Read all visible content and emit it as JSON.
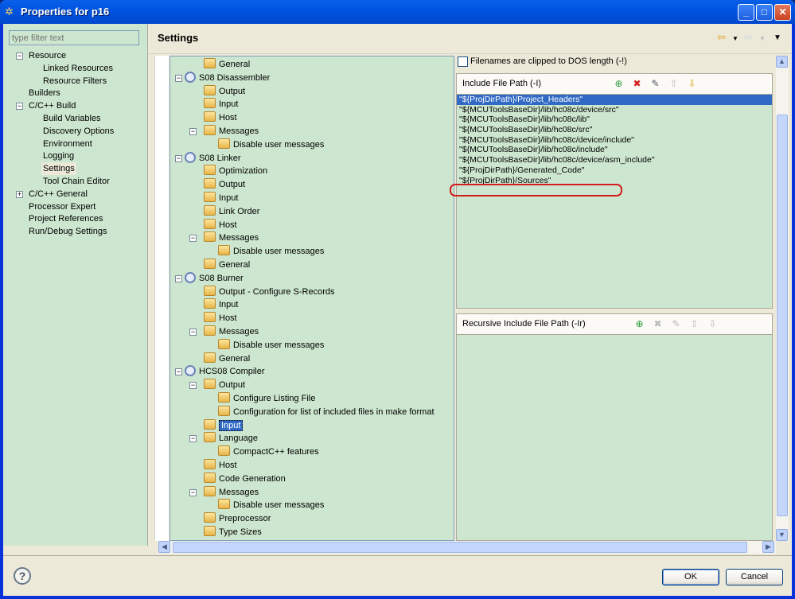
{
  "window": {
    "title": "Properties for p16",
    "controls": [
      "minimize",
      "maximize",
      "close"
    ]
  },
  "left": {
    "filter_placeholder": "type filter text",
    "items": [
      {
        "label": "Resource",
        "level": 0,
        "expander": "−"
      },
      {
        "label": "Linked Resources",
        "level": 1
      },
      {
        "label": "Resource Filters",
        "level": 1
      },
      {
        "label": "Builders",
        "level": 0
      },
      {
        "label": "C/C++ Build",
        "level": 0,
        "expander": "−"
      },
      {
        "label": "Build Variables",
        "level": 1
      },
      {
        "label": "Discovery Options",
        "level": 1
      },
      {
        "label": "Environment",
        "level": 1
      },
      {
        "label": "Logging",
        "level": 1
      },
      {
        "label": "Settings",
        "level": 1,
        "selected": true
      },
      {
        "label": "Tool Chain Editor",
        "level": 1
      },
      {
        "label": "C/C++ General",
        "level": 0,
        "expander": "+"
      },
      {
        "label": "Processor Expert",
        "level": 0
      },
      {
        "label": "Project References",
        "level": 0
      },
      {
        "label": "Run/Debug Settings",
        "level": 0
      }
    ]
  },
  "header": {
    "title": "Settings"
  },
  "tool_tree": [
    {
      "label": "General",
      "level": 1,
      "icon": "folder"
    },
    {
      "label": "S08 Disassembler",
      "level": 0,
      "icon": "tool",
      "expander": "−"
    },
    {
      "label": "Output",
      "level": 1,
      "icon": "folder"
    },
    {
      "label": "Input",
      "level": 1,
      "icon": "folder"
    },
    {
      "label": "Host",
      "level": 1,
      "icon": "folder"
    },
    {
      "label": "Messages",
      "level": 1,
      "icon": "folder",
      "expander": "−"
    },
    {
      "label": "Disable user messages",
      "level": 2,
      "icon": "folder"
    },
    {
      "label": "S08 Linker",
      "level": 0,
      "icon": "tool",
      "expander": "−"
    },
    {
      "label": "Optimization",
      "level": 1,
      "icon": "folder"
    },
    {
      "label": "Output",
      "level": 1,
      "icon": "folder"
    },
    {
      "label": "Input",
      "level": 1,
      "icon": "folder"
    },
    {
      "label": "Link Order",
      "level": 1,
      "icon": "folder"
    },
    {
      "label": "Host",
      "level": 1,
      "icon": "folder"
    },
    {
      "label": "Messages",
      "level": 1,
      "icon": "folder",
      "expander": "−"
    },
    {
      "label": "Disable user messages",
      "level": 2,
      "icon": "folder"
    },
    {
      "label": "General",
      "level": 1,
      "icon": "folder"
    },
    {
      "label": "S08 Burner",
      "level": 0,
      "icon": "tool",
      "expander": "−"
    },
    {
      "label": "Output - Configure S-Records",
      "level": 1,
      "icon": "folder"
    },
    {
      "label": "Input",
      "level": 1,
      "icon": "folder"
    },
    {
      "label": "Host",
      "level": 1,
      "icon": "folder"
    },
    {
      "label": "Messages",
      "level": 1,
      "icon": "folder",
      "expander": "−"
    },
    {
      "label": "Disable user messages",
      "level": 2,
      "icon": "folder"
    },
    {
      "label": "General",
      "level": 1,
      "icon": "folder"
    },
    {
      "label": "HCS08 Compiler",
      "level": 0,
      "icon": "tool",
      "expander": "−"
    },
    {
      "label": "Output",
      "level": 1,
      "icon": "folder",
      "expander": "−"
    },
    {
      "label": "Configure Listing File",
      "level": 2,
      "icon": "folder"
    },
    {
      "label": "Configuration for list of included files in make format",
      "level": 2,
      "icon": "folder"
    },
    {
      "label": "Input",
      "level": 1,
      "icon": "folder",
      "selected": true
    },
    {
      "label": "Language",
      "level": 1,
      "icon": "folder",
      "expander": "−"
    },
    {
      "label": "CompactC++ features",
      "level": 2,
      "icon": "folder"
    },
    {
      "label": "Host",
      "level": 1,
      "icon": "folder"
    },
    {
      "label": "Code Generation",
      "level": 1,
      "icon": "folder"
    },
    {
      "label": "Messages",
      "level": 1,
      "icon": "folder",
      "expander": "−"
    },
    {
      "label": "Disable user messages",
      "level": 2,
      "icon": "folder"
    },
    {
      "label": "Preprocessor",
      "level": 1,
      "icon": "folder"
    },
    {
      "label": "Type Sizes",
      "level": 1,
      "icon": "folder"
    }
  ],
  "options": {
    "dos_checkbox": {
      "label": "Filenames are clipped to DOS length (-!)",
      "checked": false
    },
    "include": {
      "title": "Include File Path (-I)",
      "tool_icons": [
        "add-icon",
        "delete-icon",
        "edit-icon",
        "move-up-icon",
        "move-down-icon"
      ],
      "paths": [
        "\"${ProjDirPath}/Project_Headers\"",
        "\"${MCUToolsBaseDir}/lib/hc08c/device/src\"",
        "\"${MCUToolsBaseDir}/lib/hc08c/lib\"",
        "\"${MCUToolsBaseDir}/lib/hc08c/src\"",
        "\"${MCUToolsBaseDir}/lib/hc08c/device/include\"",
        "\"${MCUToolsBaseDir}/lib/hc08c/include\"",
        "\"${MCUToolsBaseDir}/lib/hc08c/device/asm_include\"",
        "\"${ProjDirPath}/Generated_Code\"",
        "\"${ProjDirPath}/Sources\""
      ],
      "selected_index": 0,
      "highlighted_index": 7
    },
    "recursive": {
      "title": "Recursive Include File Path (-Ir)",
      "tool_icons": [
        "add-icon",
        "delete-icon",
        "edit-icon",
        "move-up-icon",
        "move-down-icon"
      ],
      "paths": []
    }
  },
  "buttons": {
    "ok": "OK",
    "cancel": "Cancel"
  },
  "colors": {
    "tree_bg": "#cde6cf",
    "selection": "#316ac5",
    "highlight_ring": "#d21d1d"
  }
}
